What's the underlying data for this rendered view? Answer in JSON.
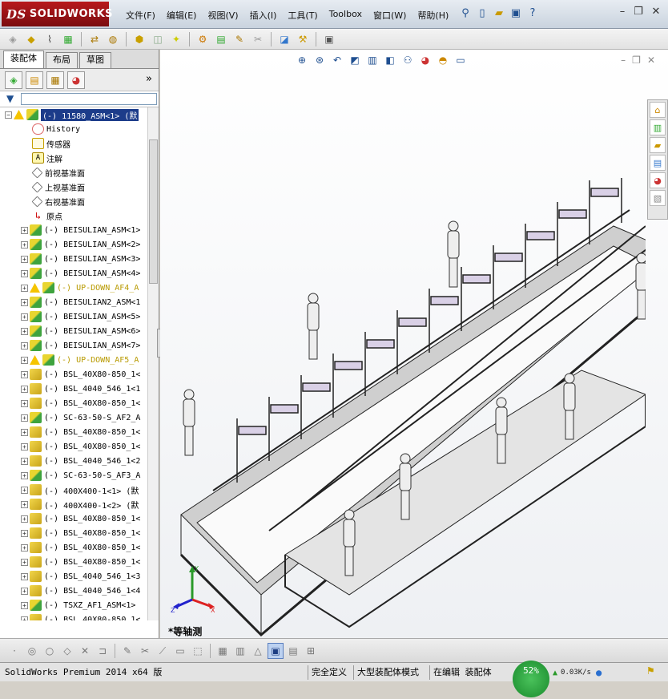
{
  "app": {
    "logo_text": "SOLIDWORKS",
    "logo_prefix": "DS"
  },
  "menu": [
    "文件(F)",
    "编辑(E)",
    "视图(V)",
    "插入(I)",
    "工具(T)",
    "Toolbox",
    "窗口(W)",
    "帮助(H)"
  ],
  "tabs": [
    "装配体",
    "布局",
    "草图"
  ],
  "tree": {
    "root": "(-) 11580_ASM<1> (默",
    "fixed": [
      "History",
      "传感器",
      "注解",
      "前视基准面",
      "上视基准面",
      "右视基准面",
      "原点"
    ],
    "items": [
      {
        "label": "(-) BEISULIAN_ASM<1>",
        "type": "asm"
      },
      {
        "label": "(-) BEISULIAN_ASM<2>",
        "type": "asm"
      },
      {
        "label": "(-) BEISULIAN_ASM<3>",
        "type": "asm"
      },
      {
        "label": "(-) BEISULIAN_ASM<4>",
        "type": "asm"
      },
      {
        "label": "(-) UP-DOWN_AF4_A",
        "type": "asm",
        "warn": true
      },
      {
        "label": "(-) BEISULIAN2_ASM<1",
        "type": "asm"
      },
      {
        "label": "(-) BEISULIAN_ASM<5>",
        "type": "asm"
      },
      {
        "label": "(-) BEISULIAN_ASM<6>",
        "type": "asm"
      },
      {
        "label": "(-) BEISULIAN_ASM<7>",
        "type": "asm"
      },
      {
        "label": "(-) UP-DOWN_AF5_A",
        "type": "asm",
        "warn": true
      },
      {
        "label": "(-) BSL_40X80-850_1<",
        "type": "part"
      },
      {
        "label": "(-) BSL_4040_546_1<1",
        "type": "part"
      },
      {
        "label": "(-) BSL_40X80-850_1<",
        "type": "part"
      },
      {
        "label": "(-) SC-63-50-S_AF2_A",
        "type": "asm"
      },
      {
        "label": "(-) BSL_40X80-850_1<",
        "type": "part"
      },
      {
        "label": "(-) BSL_40X80-850_1<",
        "type": "part"
      },
      {
        "label": "(-) BSL_4040_546_1<2",
        "type": "part"
      },
      {
        "label": "(-) SC-63-50-S_AF3_A",
        "type": "asm"
      },
      {
        "label": "(-) 400X400-1<1> (默",
        "type": "part"
      },
      {
        "label": "(-) 400X400-1<2> (默",
        "type": "part"
      },
      {
        "label": "(-) BSL_40X80-850_1<",
        "type": "part"
      },
      {
        "label": "(-) BSL_40X80-850_1<",
        "type": "part"
      },
      {
        "label": "(-) BSL_40X80-850_1<",
        "type": "part"
      },
      {
        "label": "(-) BSL_40X80-850_1<",
        "type": "part"
      },
      {
        "label": "(-) BSL_4040_546_1<3",
        "type": "part"
      },
      {
        "label": "(-) BSL_4040_546_1<4",
        "type": "part"
      },
      {
        "label": "(-) TSXZ_AF1_ASM<1>",
        "type": "asm"
      },
      {
        "label": "(-) BSL_40X80-850_1<",
        "type": "part"
      }
    ]
  },
  "viewport": {
    "view_name": "*等轴测",
    "triad": {
      "x": "X",
      "y": "Y",
      "z": "Z"
    }
  },
  "status": {
    "app_version": "SolidWorks Premium 2014 x64 版",
    "fully_defined": "完全定义",
    "large_mode": "大型装配体模式",
    "editing": "在编辑 装配体",
    "cpu_percent": "52%",
    "net_speed": "0.03K/s"
  }
}
